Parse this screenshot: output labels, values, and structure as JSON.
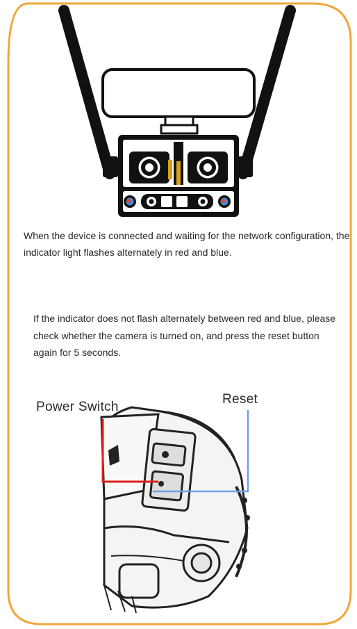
{
  "instructions": {
    "paragraph_1": "When the device is connected and waiting for the network configuration, the indicator light flashes alternately in red and blue.",
    "paragraph_2": "If the indicator does not flash alternately between red and blue, please check whether the camera is turned on, and press the reset button again for 5 seconds."
  },
  "callouts": {
    "power_switch": "Power Switch",
    "reset": "Reset"
  },
  "colors": {
    "frame_border": "#f2a63a",
    "power_switch_line": "#e0201c",
    "reset_line": "#6f9fe8",
    "indicator_red": "#e8432d",
    "indicator_blue": "#3a8fe0",
    "lens_ring": "#d6a11c"
  }
}
